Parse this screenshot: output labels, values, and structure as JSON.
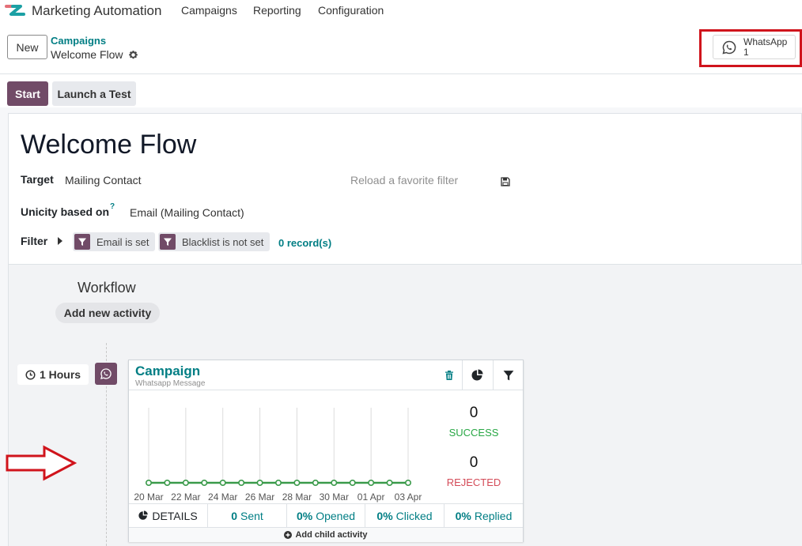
{
  "nav": {
    "app_title": "Marketing Automation",
    "items": [
      "Campaigns",
      "Reporting",
      "Configuration"
    ]
  },
  "control": {
    "new_label": "New",
    "breadcrumb_parent": "Campaigns",
    "breadcrumb_current": "Welcome Flow",
    "whatsapp_label": "WhatsApp",
    "whatsapp_count": "1"
  },
  "actions": {
    "start": "Start",
    "launch_test": "Launch a Test"
  },
  "form": {
    "title": "Welcome Flow",
    "target_label": "Target",
    "target_value": "Mailing Contact",
    "favorite_placeholder": "Reload a favorite filter",
    "unicity_label": "Unicity based on",
    "unicity_help": "?",
    "unicity_value": "Email (Mailing Contact)",
    "filter_label": "Filter",
    "filter_tags": [
      "Email is set",
      "Blacklist is not set"
    ],
    "records": "0 record(s)"
  },
  "workflow": {
    "title": "Workflow",
    "add_activity": "Add new activity",
    "delay": "1 Hours"
  },
  "activity": {
    "title": "Campaign",
    "subtitle": "Whatsapp Message",
    "success_count": "0",
    "success_label": "SUCCESS",
    "rejected_count": "0",
    "rejected_label": "REJECTED",
    "footer": {
      "details": "DETAILS",
      "sent_value": "0",
      "sent_label": "Sent",
      "opened_value": "0%",
      "opened_label": "Opened",
      "clicked_value": "0%",
      "clicked_label": "Clicked",
      "replied_value": "0%",
      "replied_label": "Replied"
    },
    "add_child": "Add child activity"
  },
  "colors": {
    "brand": "#714b67",
    "link": "#017e84",
    "success": "#28a745",
    "rejected": "#d44c59",
    "highlight": "#d0141c"
  },
  "chart_data": {
    "type": "line",
    "x": [
      "20 Mar",
      "21 Mar",
      "22 Mar",
      "23 Mar",
      "24 Mar",
      "25 Mar",
      "26 Mar",
      "27 Mar",
      "28 Mar",
      "29 Mar",
      "30 Mar",
      "31 Mar",
      "01 Apr",
      "02 Apr",
      "03 Apr"
    ],
    "tick_labels": [
      "20 Mar",
      "22 Mar",
      "24 Mar",
      "26 Mar",
      "28 Mar",
      "30 Mar",
      "01 Apr",
      "03 Apr"
    ],
    "series": [
      {
        "values": [
          0,
          0,
          0,
          0,
          0,
          0,
          0,
          0,
          0,
          0,
          0,
          0,
          0,
          0,
          0
        ],
        "color": "#3a9a4a"
      }
    ],
    "grid": "vertical"
  }
}
